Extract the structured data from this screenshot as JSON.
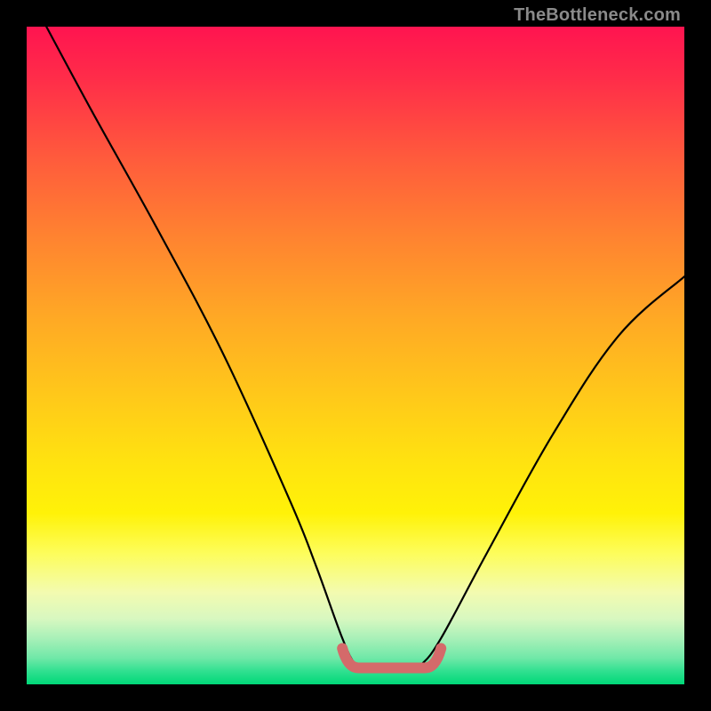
{
  "attribution": "TheBottleneck.com",
  "chart_data": {
    "type": "line",
    "title": "",
    "xlabel": "",
    "ylabel": "",
    "xlim": [
      0,
      100
    ],
    "ylim": [
      0,
      100
    ],
    "series": [
      {
        "name": "curve",
        "x": [
          3,
          10,
          20,
          30,
          40,
          44,
          48,
          50,
          52,
          55,
          58,
          60,
          63,
          70,
          80,
          90,
          100
        ],
        "y": [
          100,
          87,
          69,
          50,
          28,
          18,
          7,
          3,
          2,
          2,
          2,
          3,
          7,
          20,
          38,
          53,
          62
        ]
      }
    ],
    "flat_region": {
      "x_start": 48,
      "x_end": 63,
      "y": 2.5,
      "color": "#d46a6a"
    },
    "colors": {
      "curve": "#000000",
      "gradient_top": "#ff1450",
      "gradient_bottom": "#00d878",
      "background": "#000000"
    }
  }
}
